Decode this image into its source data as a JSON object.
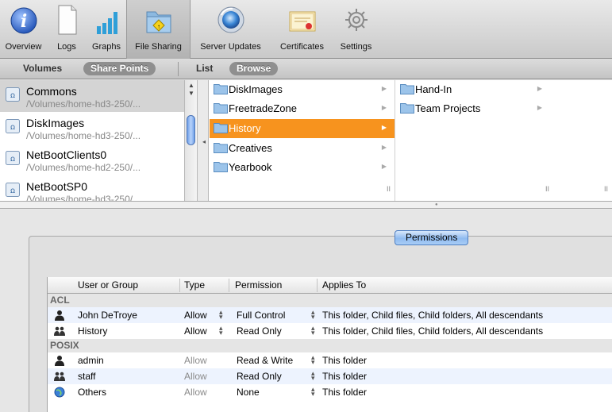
{
  "toolbar": {
    "items": [
      {
        "label": "Overview",
        "icon": "info-icon"
      },
      {
        "label": "Logs",
        "icon": "document-icon"
      },
      {
        "label": "Graphs",
        "icon": "bar-graph-icon"
      },
      {
        "label": "File Sharing",
        "icon": "shared-folder-icon"
      },
      {
        "label": "Server Updates",
        "icon": "software-update-icon"
      },
      {
        "label": "Certificates",
        "icon": "certificate-icon"
      },
      {
        "label": "Settings",
        "icon": "gear-icon"
      }
    ],
    "selected": "File Sharing"
  },
  "scopebar": {
    "volumes_label": "Volumes",
    "share_points_label": "Share Points",
    "list_label": "List",
    "browse_label": "Browse"
  },
  "share_points": [
    {
      "name": "Commons",
      "path": "/Volumes/home-hd3-250/...",
      "selected": true
    },
    {
      "name": "DiskImages",
      "path": "/Volumes/home-hd3-250/...",
      "selected": false
    },
    {
      "name": "NetBootClients0",
      "path": "/Volumes/home-hd2-250/...",
      "selected": false
    },
    {
      "name": "NetBootSP0",
      "path": "/Volumes/home-hd3-250/...",
      "selected": false
    }
  ],
  "browser": {
    "column1": [
      "DiskImages",
      "FreetradeZone",
      "History",
      "Creatives",
      "Yearbook"
    ],
    "column1_selected": "History",
    "column2": [
      "Hand-In",
      "Team Projects"
    ]
  },
  "permissions_tab_label": "Permissions",
  "acl_table": {
    "headers": [
      "User or Group",
      "Type",
      "Permission",
      "Applies To"
    ],
    "groups": [
      {
        "label": "ACL",
        "rows": [
          {
            "name": "John DeTroye",
            "kind": "user",
            "type": "Allow",
            "permission": "Full Control",
            "applies_to": "This folder, Child files, Child folders, All descendants"
          },
          {
            "name": "History",
            "kind": "group",
            "type": "Allow",
            "permission": "Read Only",
            "applies_to": "This folder, Child files, Child folders, All descendants"
          }
        ]
      },
      {
        "label": "POSIX",
        "rows": [
          {
            "name": "admin",
            "kind": "user",
            "type": "Allow",
            "permission": "Read & Write",
            "applies_to": "This folder"
          },
          {
            "name": "staff",
            "kind": "group",
            "type": "Allow",
            "permission": "Read Only",
            "applies_to": "This folder"
          },
          {
            "name": "Others",
            "kind": "globe",
            "type": "Allow",
            "permission": "None",
            "applies_to": "This folder"
          }
        ]
      }
    ]
  },
  "colors": {
    "selection_orange": "#f7931e",
    "tab_blue": "#8fbbf0",
    "row_alt": "#edf3fe"
  }
}
